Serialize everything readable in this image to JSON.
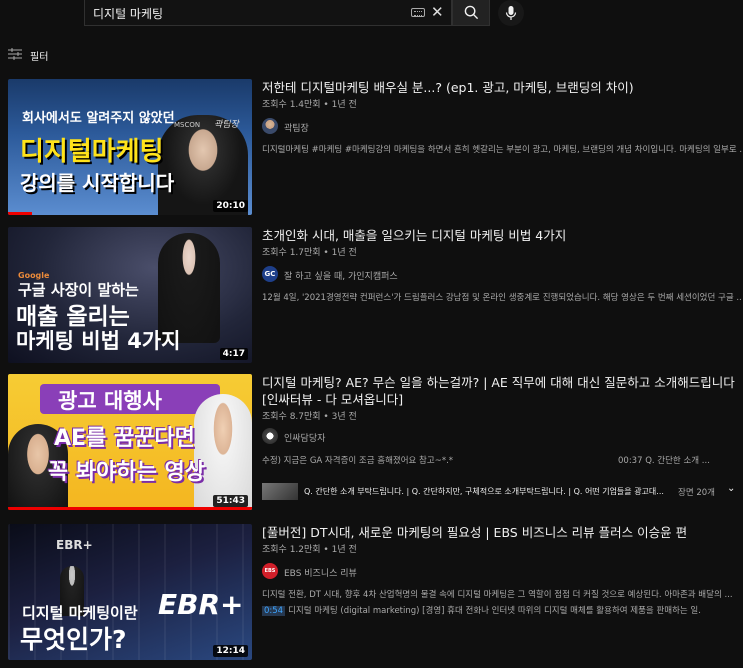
{
  "search": {
    "value": "디지털 마케팅"
  },
  "filter": {
    "label": "필터"
  },
  "videos": [
    {
      "title": "저한테 디지털마케팅 배우실 분...? (ep1. 광고, 마케팅, 브랜딩의 차이)",
      "meta": "조회수 1.4만회 • 1년 전",
      "channel": "곽팀장",
      "description": "디지털마케팅 #마케팅 #마케팅강의 마케팅을 하면서 흔히 헷갈리는 부분이 광고, 마케팅, 브랜딩의 개념 차이입니다. 마케팅의 일부로 ...",
      "duration": "20:10",
      "thumb": {
        "line1": "회사에서도 알려주지 않았던",
        "line2": "디지털마케팅",
        "line3": "강의를 시작합니다",
        "brand": "MSCON",
        "sign": "곽팀장"
      },
      "progress": 0.1
    },
    {
      "title": "초개인화 시대, 매출을 일으키는 디지털 마케팅 비법 4가지",
      "meta": "조회수 1.7만회 • 1년 전",
      "channel": "잘 하고 싶을 때, 가인지캠퍼스",
      "channel_badge": "GC",
      "description": "12월 4일, '2021경영전략 컨퍼런스'가 드림플러스 강남점 및 온라인 생중계로 진행되었습니다. 해당 영상은 두 번째 세션이었던 구글 ...",
      "duration": "4:17",
      "thumb": {
        "line0": "Google",
        "line1": "구글 사장이 말하는",
        "line2": "매출 올리는",
        "line3": "마케팅 비법 4가지"
      }
    },
    {
      "title": "디지털 마케팅? AE? 무슨 일을 하는걸까? | AE 직무에 대해 대신 질문하고 소개해드립니다 [인싸터뷰 - 다 모셔옵니다]",
      "meta": "조회수 8.7만회 • 3년 전",
      "channel": "인싸담당자",
      "description_left": "수정) 지금은 GA 자격증이 조금 흠해졌어요 참고~*.*",
      "description_right": "00:37 Q. 간단한 소개 ...",
      "chapters": "Q. 간단한 소개 부탁드립니다. | Q. 간단하지만, 구체적으로 소개부탁드립니다. | Q. 어떤 기업들을 광고대...",
      "chapters_count": "장면 20개",
      "duration": "51:43",
      "thumb": {
        "line1": "광고 대행사",
        "line2": "AE를 꿈꾼다면",
        "line3": "꼭 봐야하는 영상"
      },
      "progress": 1.0
    },
    {
      "title": "[풀버전] DT시대, 새로운 마케팅의 필요성 | EBS 비즈니스 리뷰 플러스 이승윤 편",
      "meta": "조회수 1.2만회 • 1년 전",
      "channel": "EBS 비즈니스 리뷰",
      "channel_badge": "EBS",
      "description": "디지털 전환, DT 시대, 향후 4차 산업혁명의 물결 속에 디지털 마케팅은 그 역할이 점점 더 커질 것으로 예상된다. 아마존과 배달의 ...",
      "timestamp": "0:54",
      "timestamp_text": "디지털 마케팅 (digital marketing) [경영] 휴대 전화나 인터넷 따위의 디지털 매체를 활용하여 제품을 판매하는 일.",
      "duration": "12:14",
      "thumb": {
        "brand": "EBR+",
        "line1": "디지털 마케팅이란",
        "line2": "무엇인가?"
      }
    }
  ],
  "colors": {
    "background": "#0f0f0f",
    "text": "#f1f1f1",
    "secondary": "#aaaaaa",
    "progress": "#ff0000",
    "link": "#3ea6ff"
  }
}
